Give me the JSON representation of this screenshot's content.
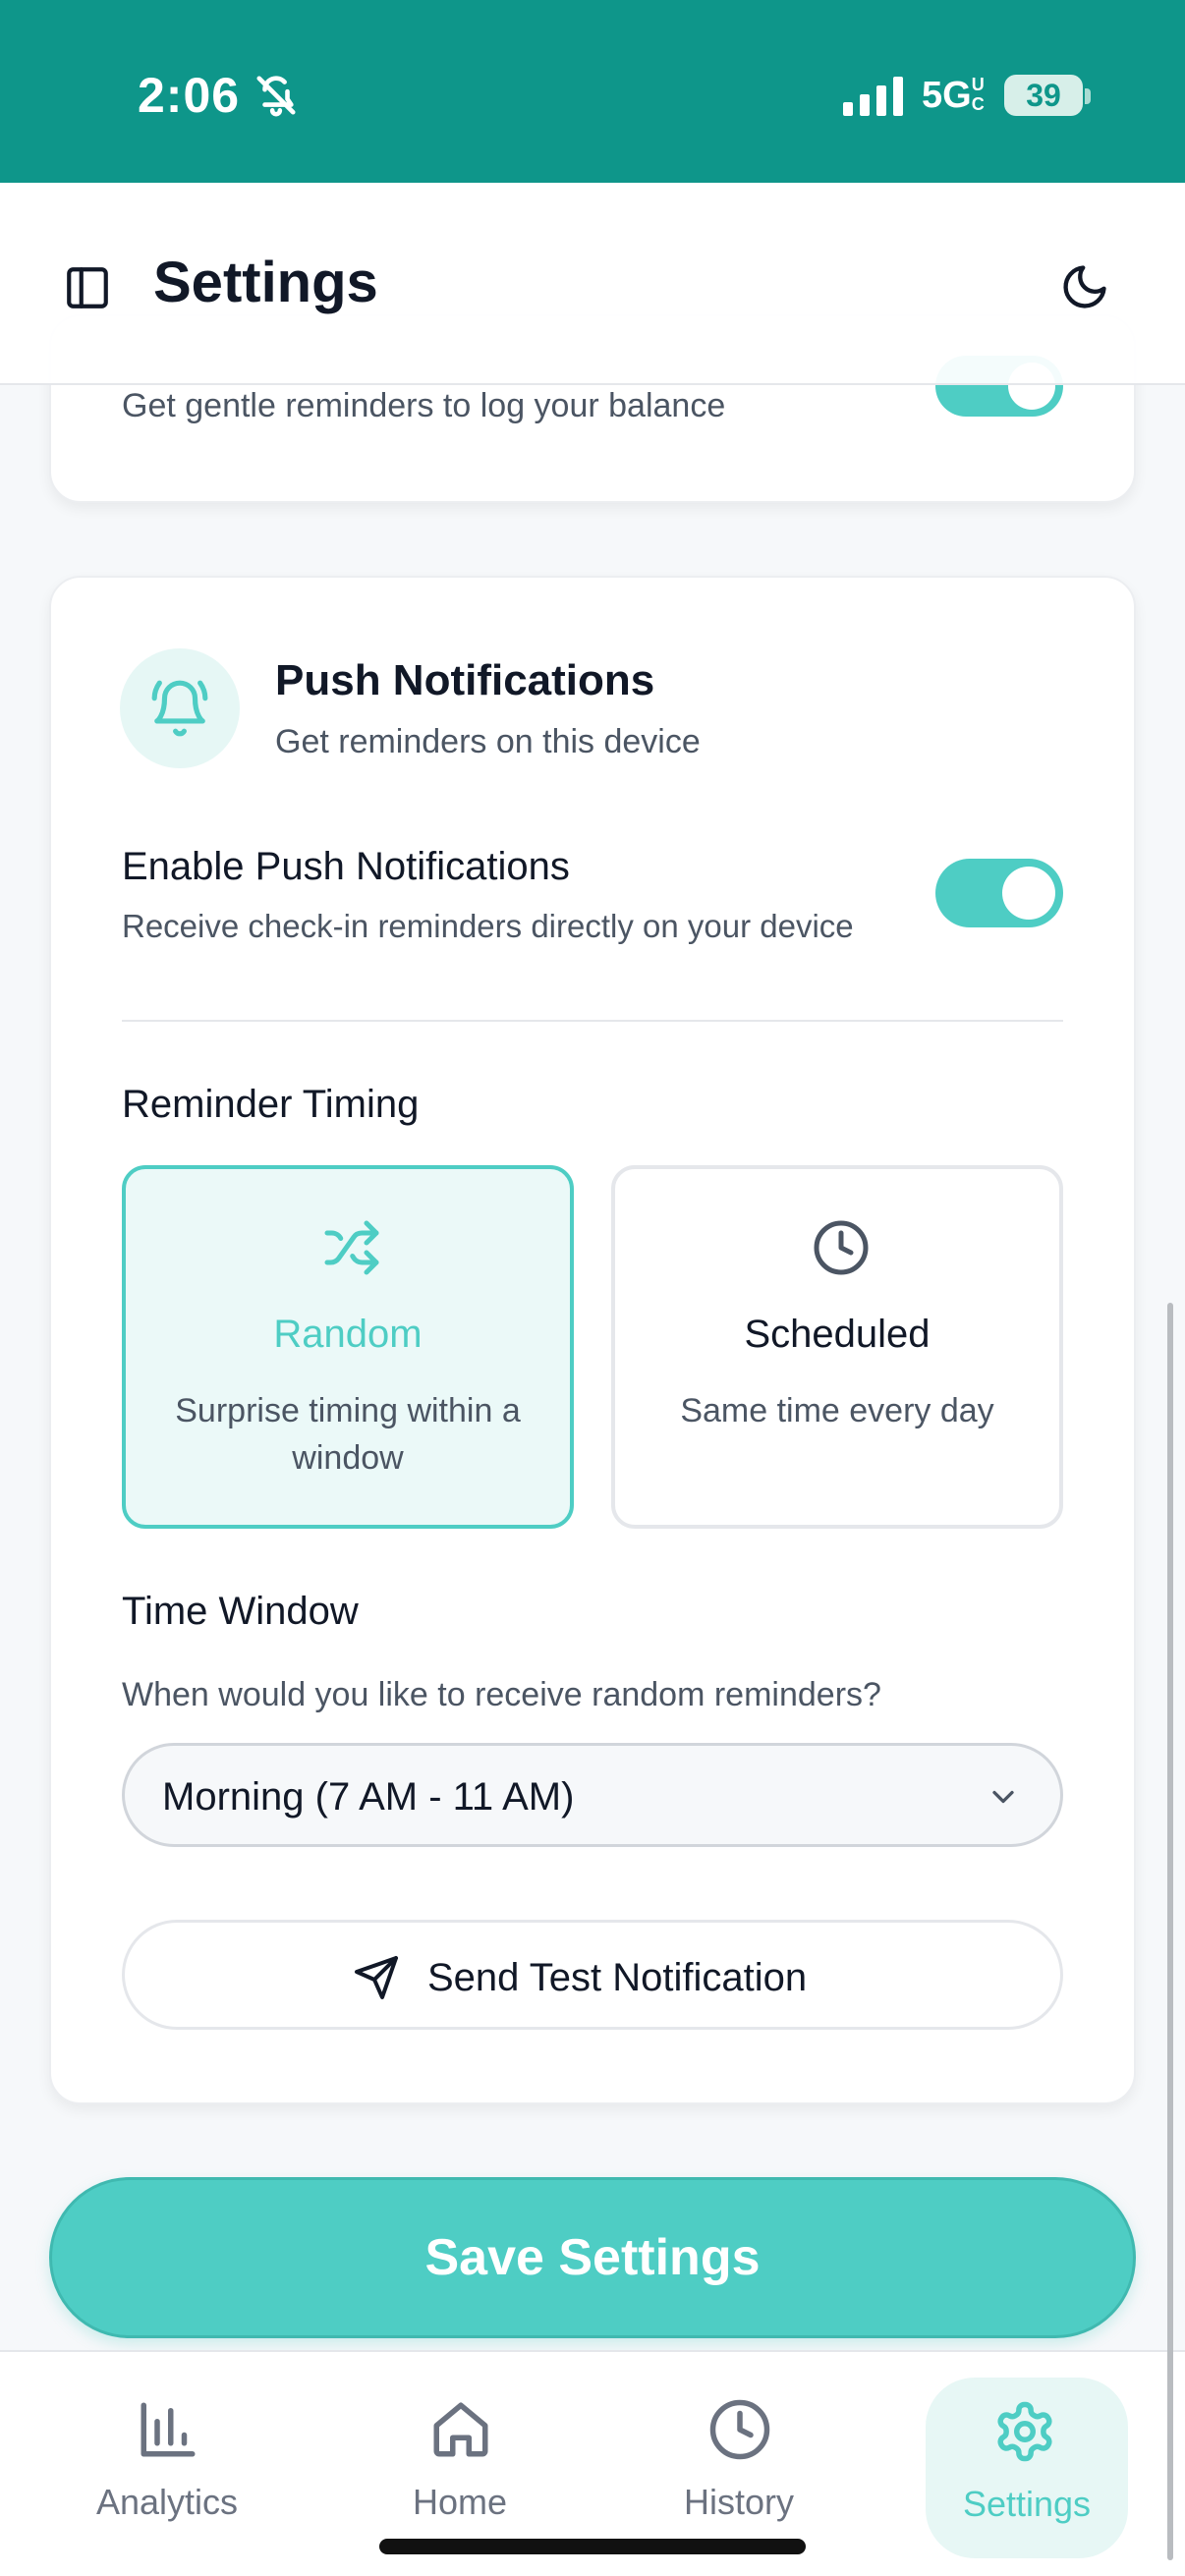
{
  "status_bar": {
    "time": "2:06",
    "network": "5G",
    "network_suffix": "UC",
    "battery": "39",
    "icons": [
      "bell-slash-icon",
      "cellular-signal-icon",
      "battery-icon"
    ]
  },
  "header": {
    "title": "Settings",
    "icons": [
      "sidebar-toggle-icon",
      "moon-icon"
    ]
  },
  "reminder_card": {
    "subtitle": "Get gentle reminders to log your balance",
    "toggle_on": true
  },
  "push_card": {
    "icon": "bell-ringing-icon",
    "title": "Push Notifications",
    "subtitle": "Get reminders on this device",
    "enable_label": "Enable Push Notifications",
    "enable_desc": "Receive check-in reminders directly on your device",
    "enable_on": true,
    "timing_label": "Reminder Timing",
    "options": [
      {
        "title": "Random",
        "desc": "Surprise timing within a window",
        "icon": "shuffle-icon",
        "selected": true
      },
      {
        "title": "Scheduled",
        "desc": "Same time every day",
        "icon": "clock-icon",
        "selected": false
      }
    ],
    "window_label": "Time Window",
    "window_desc": "When would you like to receive random reminders?",
    "window_value": "Morning (7 AM - 11 AM)",
    "test_button": "Send Test Notification"
  },
  "save_button": "Save Settings",
  "nav": {
    "items": [
      {
        "label": "Analytics",
        "icon": "bar-chart-icon"
      },
      {
        "label": "Home",
        "icon": "home-icon"
      },
      {
        "label": "History",
        "icon": "clock-icon"
      },
      {
        "label": "Settings",
        "icon": "gear-icon",
        "active": true
      }
    ]
  },
  "colors": {
    "status_bar": "#0e968a",
    "accent": "#4ecdc4",
    "accent_soft": "#e6f7f5",
    "text": "#111827",
    "muted": "#4b5563"
  }
}
